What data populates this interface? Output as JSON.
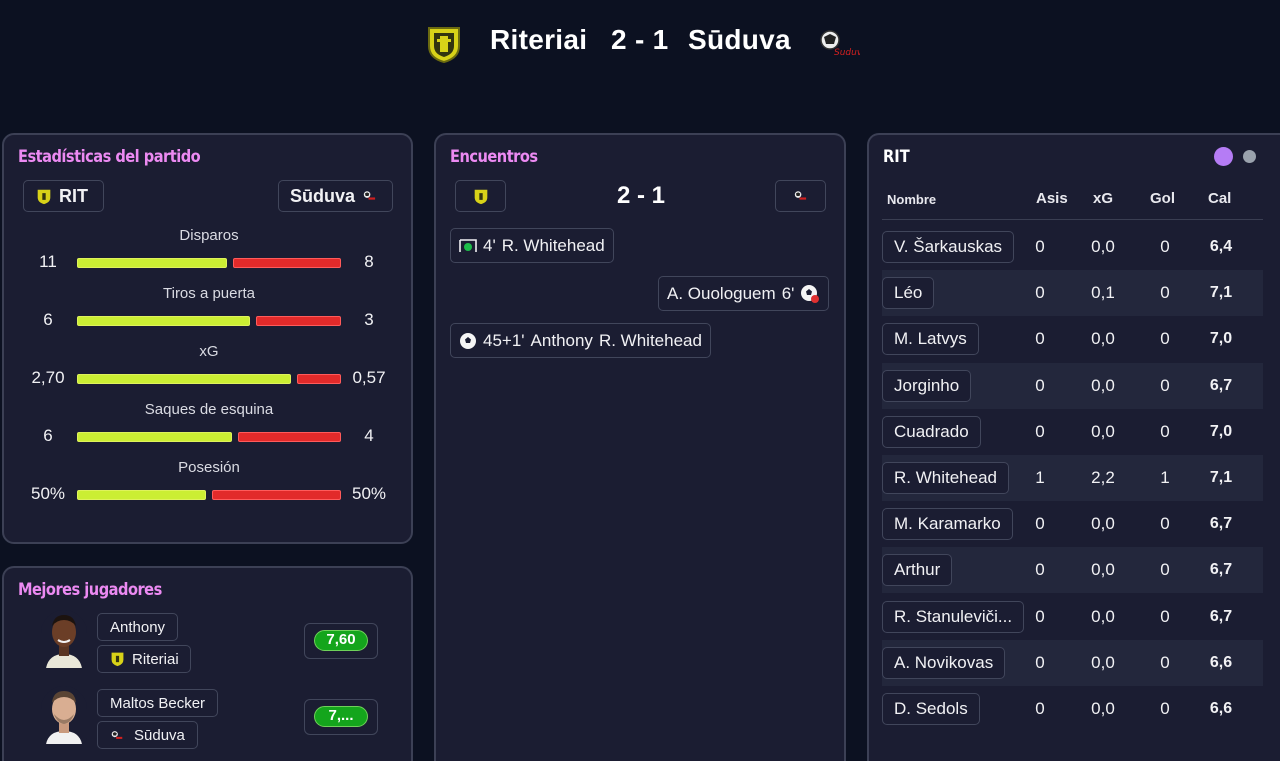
{
  "match": {
    "home_name": "Riteriai",
    "score": "2 - 1",
    "away_name": "Sūduva"
  },
  "colors": {
    "background": "#0c1121",
    "panel": "#1b1d32",
    "accent_title": "#ec8af2",
    "home_bar": "#cbee33",
    "away_bar": "#e22a2a",
    "rating_green": "#14a51c",
    "toggle_active": "#b57cf5"
  },
  "stats_panel": {
    "title": "Estadísticas del partido",
    "home_abbr": "RIT",
    "away_name": "Sūduva",
    "stats": [
      {
        "label": "Disparos",
        "home": "11",
        "away": "8",
        "home_share": 0.58
      },
      {
        "label": "Tiros a puerta",
        "home": "6",
        "away": "3",
        "home_share": 0.67
      },
      {
        "label": "xG",
        "home": "2,70",
        "away": "0,57",
        "home_share": 0.83
      },
      {
        "label": "Saques de esquina",
        "home": "6",
        "away": "4",
        "home_share": 0.6
      },
      {
        "label": "Posesión",
        "home": "50%",
        "away": "50%",
        "home_share": 0.5
      }
    ]
  },
  "best_players": {
    "title": "Mejores jugadores",
    "players": [
      {
        "name": "Anthony",
        "team": "Riteriai",
        "rating": "7,60"
      },
      {
        "name": "Maltos Becker",
        "team": "Sūduva",
        "rating": "7,..."
      }
    ]
  },
  "events_panel": {
    "title": "Encuentros",
    "score": "2 - 1",
    "events": [
      {
        "minute": "4'",
        "player": "R. Whitehead",
        "assist": "",
        "side": "home",
        "icon": "own-goal-icon"
      },
      {
        "minute": "6'",
        "player": "A. Ouologuem",
        "assist": "",
        "side": "away",
        "icon": "goal-ball-icon"
      },
      {
        "minute": "45+1'",
        "player": "Anthony",
        "assist": "R. Whitehead",
        "side": "home",
        "icon": "goal-ball-icon"
      }
    ]
  },
  "players_table": {
    "team_abbr": "RIT",
    "headers": {
      "name": "Nombre",
      "assists": "Asis",
      "xg": "xG",
      "goals": "Gol",
      "rating": "Cal"
    },
    "rows": [
      {
        "name": "V. Šarkauskas",
        "assists": "0",
        "xg": "0,0",
        "goals": "0",
        "rating": "6,4"
      },
      {
        "name": "Léo",
        "assists": "0",
        "xg": "0,1",
        "goals": "0",
        "rating": "7,1"
      },
      {
        "name": "M. Latvys",
        "assists": "0",
        "xg": "0,0",
        "goals": "0",
        "rating": "7,0"
      },
      {
        "name": "Jorginho",
        "assists": "0",
        "xg": "0,0",
        "goals": "0",
        "rating": "6,7"
      },
      {
        "name": "Cuadrado",
        "assists": "0",
        "xg": "0,0",
        "goals": "0",
        "rating": "7,0"
      },
      {
        "name": "R. Whitehead",
        "assists": "1",
        "xg": "2,2",
        "goals": "1",
        "rating": "7,1"
      },
      {
        "name": "M. Karamarko",
        "assists": "0",
        "xg": "0,0",
        "goals": "0",
        "rating": "6,7"
      },
      {
        "name": "Arthur",
        "assists": "0",
        "xg": "0,0",
        "goals": "0",
        "rating": "6,7"
      },
      {
        "name": "R. Stanuleviči...",
        "assists": "0",
        "xg": "0,0",
        "goals": "0",
        "rating": "6,7"
      },
      {
        "name": "A. Novikovas",
        "assists": "0",
        "xg": "0,0",
        "goals": "0",
        "rating": "6,6"
      },
      {
        "name": "D. Sedols",
        "assists": "0",
        "xg": "0,0",
        "goals": "0",
        "rating": "6,6"
      }
    ]
  }
}
